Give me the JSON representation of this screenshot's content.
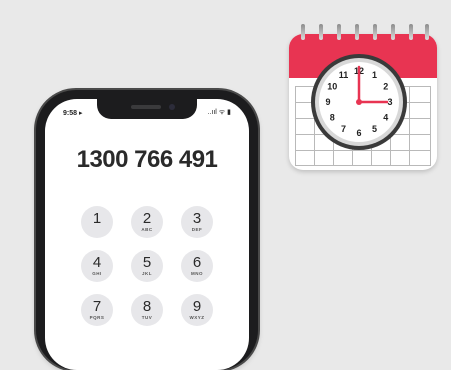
{
  "phone": {
    "status_time": "9:58 ▸",
    "status_icons": "..ııl ᯤ ▮",
    "phone_number": "1300 766 491",
    "keys": [
      {
        "digit": "1",
        "letters": ""
      },
      {
        "digit": "2",
        "letters": "ABC"
      },
      {
        "digit": "3",
        "letters": "DEF"
      },
      {
        "digit": "4",
        "letters": "GHI"
      },
      {
        "digit": "5",
        "letters": "JKL"
      },
      {
        "digit": "6",
        "letters": "MNO"
      },
      {
        "digit": "7",
        "letters": "PQRS"
      },
      {
        "digit": "8",
        "letters": "TUV"
      },
      {
        "digit": "9",
        "letters": "WXYZ"
      }
    ]
  },
  "calendar_icon": {
    "header_color": "#e83452",
    "clock_numbers": [
      "12",
      "1",
      "2",
      "3",
      "4",
      "5",
      "6",
      "7",
      "8",
      "9",
      "10",
      "11"
    ],
    "clock_time": "3:00"
  }
}
